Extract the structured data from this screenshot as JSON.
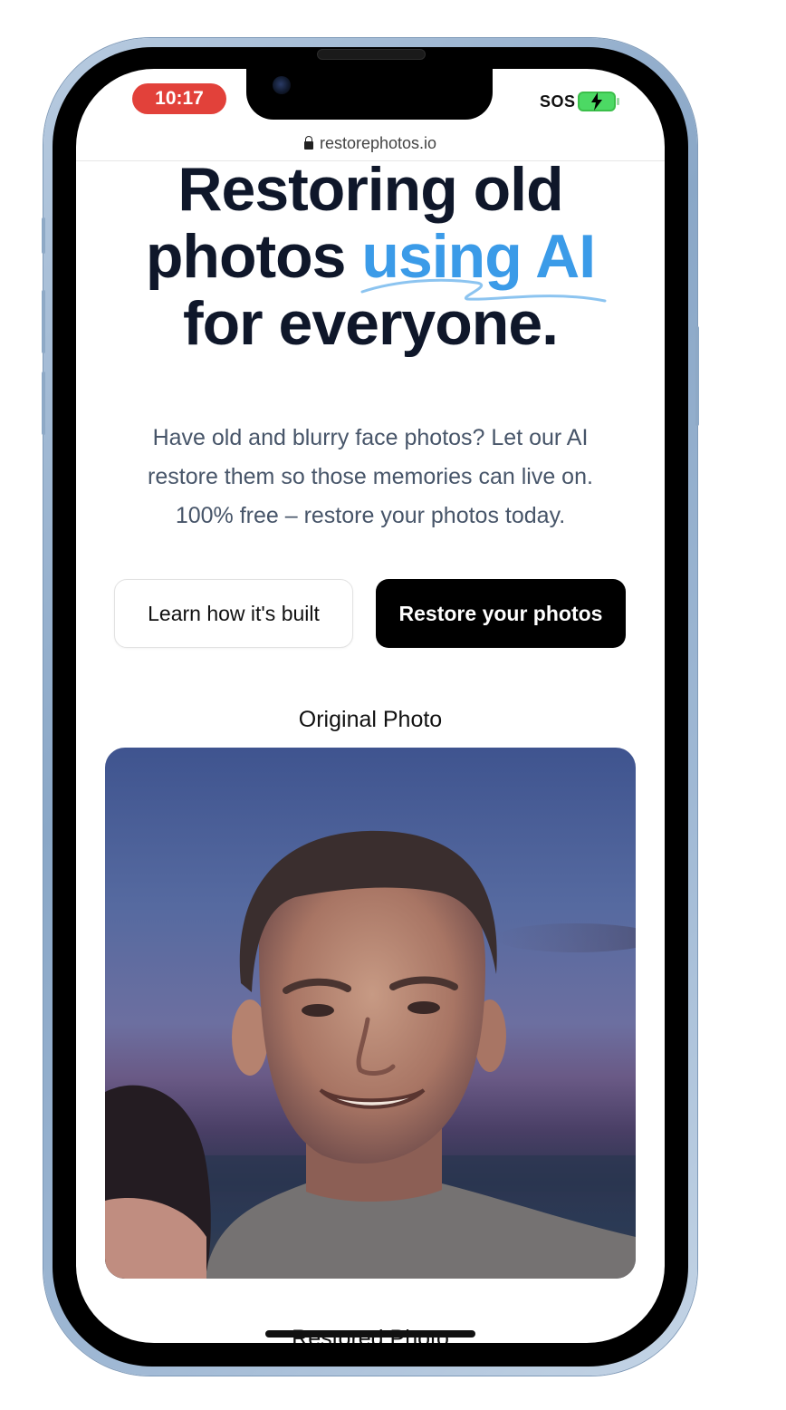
{
  "status_bar": {
    "time": "10:17",
    "carrier": "SOS",
    "battery_icon": "battery-charging-icon",
    "time_pill_color": "#e2413a"
  },
  "browser": {
    "url": "restorephotos.io",
    "lock_icon": "lock-icon"
  },
  "hero": {
    "headline_line1": "Restoring old",
    "headline_line2_plain": "photos ",
    "headline_line2_accent": "using AI",
    "headline_line3": "for everyone.",
    "accent_color": "#3b9be8",
    "subtitle_line1": "Have old and blurry face photos? Let our AI",
    "subtitle_line2": "restore them so those memories can live on.",
    "subtitle_line3": "100% free – restore your photos today."
  },
  "actions": {
    "learn_label": "Learn how it's built",
    "restore_label": "Restore your photos"
  },
  "gallery": {
    "original_label": "Original Photo",
    "restored_label": "Restored Photo"
  }
}
